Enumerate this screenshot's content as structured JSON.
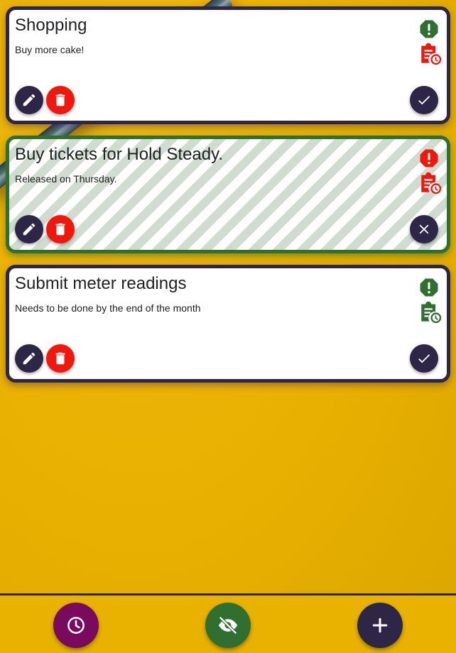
{
  "colors": {
    "primary": "#2d2646",
    "danger": "#f0170c",
    "success": "#2f6f30",
    "background": "#e9b200",
    "schedule_button": "#7a0a5e"
  },
  "tasks": [
    {
      "title": "Shopping",
      "description": "Buy more cake!",
      "status": "active",
      "priority_icon": "alert-octagon-icon",
      "schedule_icon": "clipboard-clock-icon",
      "icon_color": "#2f6f30",
      "schedule_icon_color": "#f0170c",
      "actions": [
        "edit",
        "delete",
        "complete"
      ]
    },
    {
      "title": "Buy tickets for Hold Steady.",
      "description": "Released on Thursday.",
      "status": "completed",
      "priority_icon": "alert-octagon-icon",
      "schedule_icon": "clipboard-clock-icon",
      "icon_color": "#f0170c",
      "schedule_icon_color": "#f0170c",
      "actions": [
        "edit",
        "delete",
        "uncomplete"
      ]
    },
    {
      "title": "Submit meter readings",
      "description": "Needs to be done by the end of the month",
      "status": "active",
      "priority_icon": "alert-octagon-icon",
      "schedule_icon": "clipboard-clock-icon",
      "icon_color": "#2f6f30",
      "schedule_icon_color": "#2f6f30",
      "actions": [
        "edit",
        "delete",
        "complete"
      ]
    }
  ],
  "bottom_bar": {
    "schedule_icon": "clock-icon",
    "visibility_icon": "eye-off-icon",
    "add_icon": "plus-icon"
  }
}
